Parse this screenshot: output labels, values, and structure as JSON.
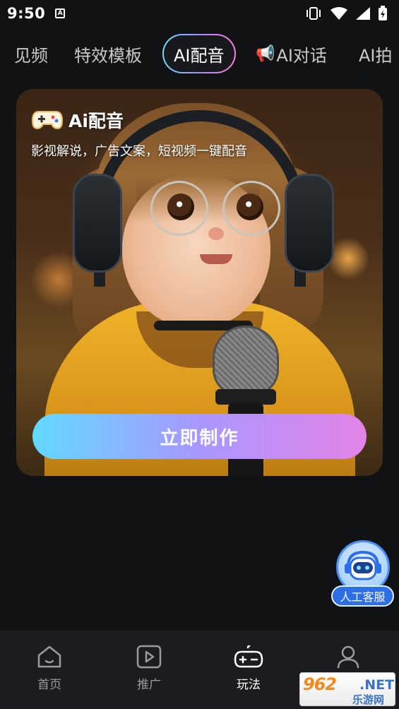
{
  "status_bar": {
    "time": "9:50",
    "notification_glyph": "A"
  },
  "tabs": [
    {
      "label": "见频",
      "active": false
    },
    {
      "label": "特效模板",
      "active": false
    },
    {
      "label": "AI配音",
      "active": true
    },
    {
      "label": "AI对话",
      "icon": "megaphone-icon",
      "active": false
    },
    {
      "label": "AI拍",
      "active": false
    }
  ],
  "hero": {
    "title": "Ai配音",
    "subtitle": "影视解说，广告文案，短视频一键配音",
    "button_label": "立即制作",
    "badge_icon": "gamepad-icon"
  },
  "customer_service": {
    "label": "人工客服",
    "icon": "robot-icon"
  },
  "bottom_nav": [
    {
      "label": "首页",
      "icon": "home-icon",
      "active": false
    },
    {
      "label": "推广",
      "icon": "play-icon",
      "active": false
    },
    {
      "label": "玩法",
      "icon": "gamepad-icon",
      "active": true
    },
    {
      "label": "",
      "icon": "user-icon",
      "active": false
    }
  ],
  "watermark": {
    "top": "962",
    "net": ".NET",
    "bottom": "乐游网"
  },
  "colors": {
    "background": "#111214",
    "accent_start": "#62d9ff",
    "accent_end": "#e383e6",
    "cs_blue": "#2f6fe6"
  }
}
